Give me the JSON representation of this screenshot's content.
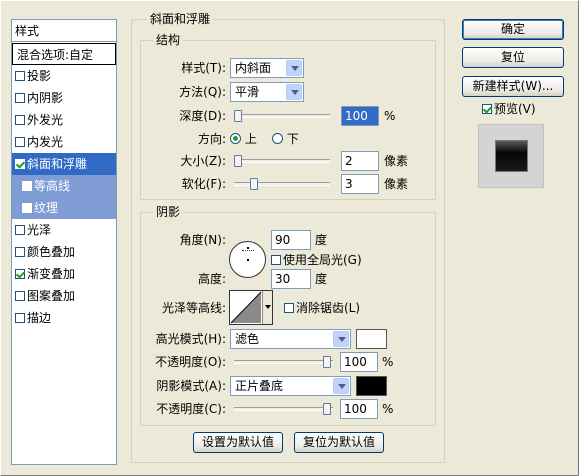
{
  "sidebar": {
    "header": "样式",
    "items": [
      {
        "label": "混合选项:自定",
        "checkbox": false,
        "checked": false,
        "state": "header"
      },
      {
        "label": "投影",
        "checkbox": true,
        "checked": false,
        "state": "normal"
      },
      {
        "label": "内阴影",
        "checkbox": true,
        "checked": false,
        "state": "normal"
      },
      {
        "label": "外发光",
        "checkbox": true,
        "checked": false,
        "state": "normal"
      },
      {
        "label": "内发光",
        "checkbox": true,
        "checked": false,
        "state": "normal"
      },
      {
        "label": "斜面和浮雕",
        "checkbox": true,
        "checked": true,
        "state": "selected"
      },
      {
        "label": "等高线",
        "checkbox": true,
        "checked": false,
        "state": "sub"
      },
      {
        "label": "纹理",
        "checkbox": true,
        "checked": false,
        "state": "sub"
      },
      {
        "label": "光泽",
        "checkbox": true,
        "checked": false,
        "state": "normal"
      },
      {
        "label": "颜色叠加",
        "checkbox": true,
        "checked": false,
        "state": "normal"
      },
      {
        "label": "渐变叠加",
        "checkbox": true,
        "checked": true,
        "state": "normal"
      },
      {
        "label": "图案叠加",
        "checkbox": true,
        "checked": false,
        "state": "normal"
      },
      {
        "label": "描边",
        "checkbox": true,
        "checked": false,
        "state": "normal"
      }
    ]
  },
  "main": {
    "title": "斜面和浮雕",
    "structure": {
      "title": "结构",
      "style_label": "样式(T):",
      "style_value": "内斜面",
      "method_label": "方法(Q):",
      "method_value": "平滑",
      "depth_label": "深度(D):",
      "depth_value": "100",
      "depth_slider": 0.0,
      "depth_unit": "%",
      "direction_label": "方向:",
      "dir_up": "上",
      "dir_down": "下",
      "size_label": "大小(Z):",
      "size_value": "2",
      "size_slider": 0.0,
      "size_unit": "像素",
      "soften_label": "软化(F):",
      "soften_value": "3",
      "soften_slider": 0.19,
      "soften_unit": "像素"
    },
    "shading": {
      "title": "阴影",
      "angle_label": "角度(N):",
      "angle_value": "90",
      "angle_unit": "度",
      "global_light_label": "使用全局光(G)",
      "altitude_label": "高度:",
      "altitude_value": "30",
      "altitude_unit": "度",
      "gloss_label": "光泽等高线:",
      "antialias_label": "消除锯齿(L)",
      "highlight_mode_label": "高光模式(H):",
      "highlight_mode_value": "滤色",
      "highlight_color": "#ffffff",
      "highlight_opacity_label": "不透明度(O):",
      "highlight_opacity_value": "100",
      "highlight_opacity_slider": 1.0,
      "highlight_opacity_unit": "%",
      "shadow_mode_label": "阴影模式(A):",
      "shadow_mode_value": "正片叠底",
      "shadow_color": "#000000",
      "shadow_opacity_label": "不透明度(C):",
      "shadow_opacity_value": "100",
      "shadow_opacity_slider": 1.0,
      "shadow_opacity_unit": "%"
    },
    "make_default": "设置为默认值",
    "reset_default": "复位为默认值"
  },
  "right": {
    "ok": "确定",
    "reset": "复位",
    "new_style": "新建样式(W)...",
    "preview_label": "预览(V)",
    "preview_checked": true
  },
  "colors": {
    "selection": "#316ac5",
    "sub_selection": "#7f9cd4",
    "dialog_bg": "#ece9d8"
  }
}
